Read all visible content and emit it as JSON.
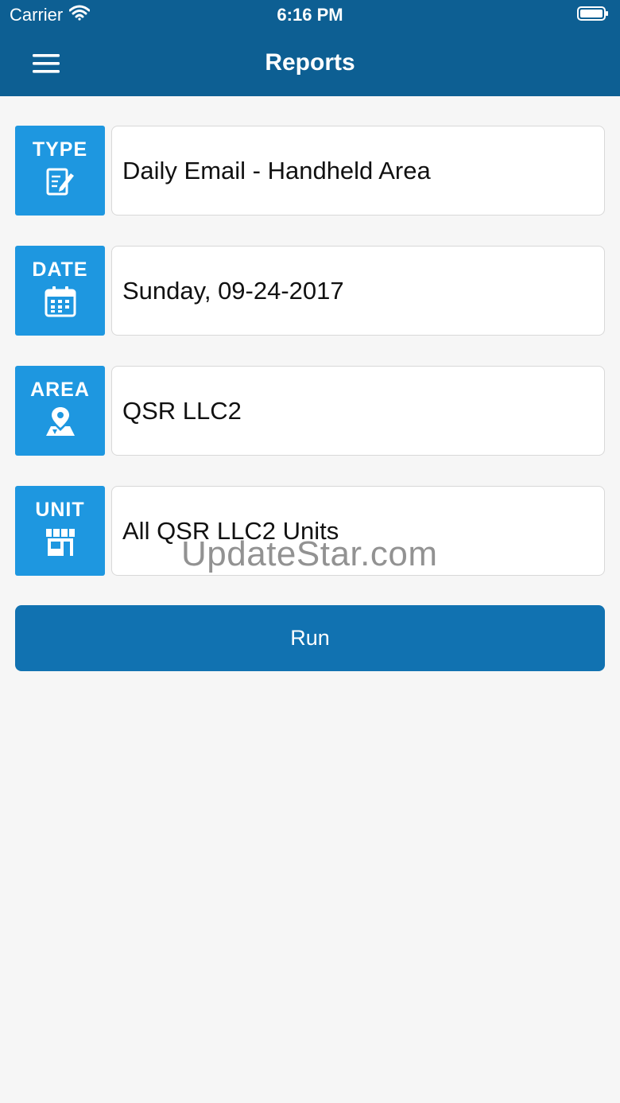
{
  "status_bar": {
    "carrier": "Carrier",
    "time": "6:16 PM",
    "wifi_icon": "wifi-icon",
    "battery_icon": "battery-icon"
  },
  "header": {
    "title": "Reports",
    "menu_icon": "hamburger-menu-icon"
  },
  "rows": [
    {
      "tag": "TYPE",
      "icon": "report-edit-icon",
      "value": "Daily Email - Handheld Area"
    },
    {
      "tag": "DATE",
      "icon": "calendar-icon",
      "value": "Sunday, 09-24-2017"
    },
    {
      "tag": "AREA",
      "icon": "map-pin-icon",
      "value": "QSR LLC2"
    },
    {
      "tag": "UNIT",
      "icon": "storefront-icon",
      "value": "All QSR LLC2 Units"
    }
  ],
  "run_button": {
    "label": "Run"
  },
  "watermark": "UpdateStar.com",
  "colors": {
    "header_bg": "#0d5f93",
    "tag_bg": "#1e97e0",
    "run_bg": "#1172b1",
    "page_bg": "#f6f6f6"
  }
}
